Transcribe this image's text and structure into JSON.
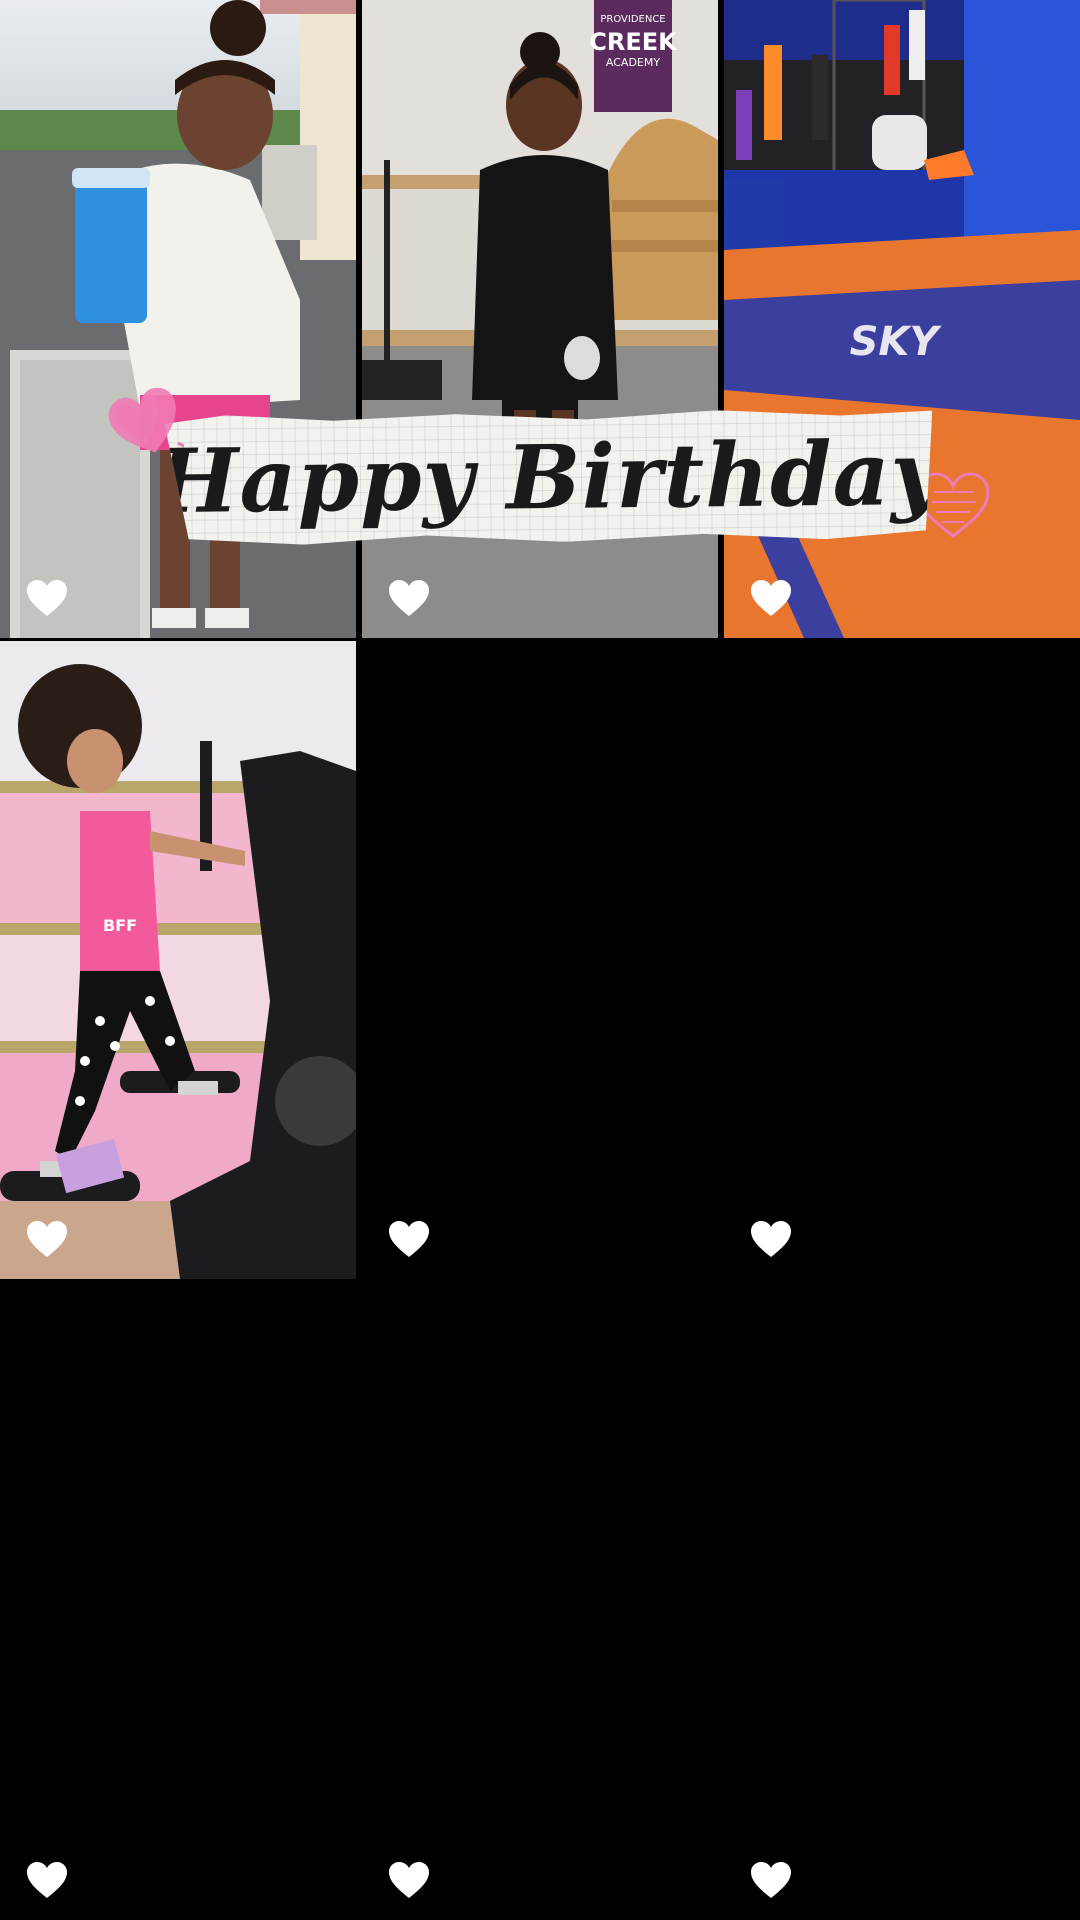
{
  "banner": {
    "text": "Happy Birthday"
  },
  "photo_tiles": [
    {
      "id": "girl-blue-drink",
      "icons": [
        "heart-icon"
      ]
    },
    {
      "id": "girl-academy",
      "sign_text": "PROVIDENCE CREEK ACADEMY",
      "icons": [
        "heart-icon"
      ]
    },
    {
      "id": "trampoline-park",
      "mat_text": "SKY",
      "icons": [
        "heart-icon"
      ]
    },
    {
      "id": "girl-elliptical",
      "shirt_text": "BFF",
      "icons": [
        "heart-icon"
      ]
    }
  ],
  "empty_tiles_count": 5,
  "colors": {
    "background": "#000000",
    "heart": "#ffffff",
    "doodle_pink": "#f07ab4",
    "banner_paper": "#f2f2ef",
    "banner_text": "#1a1a1a"
  }
}
